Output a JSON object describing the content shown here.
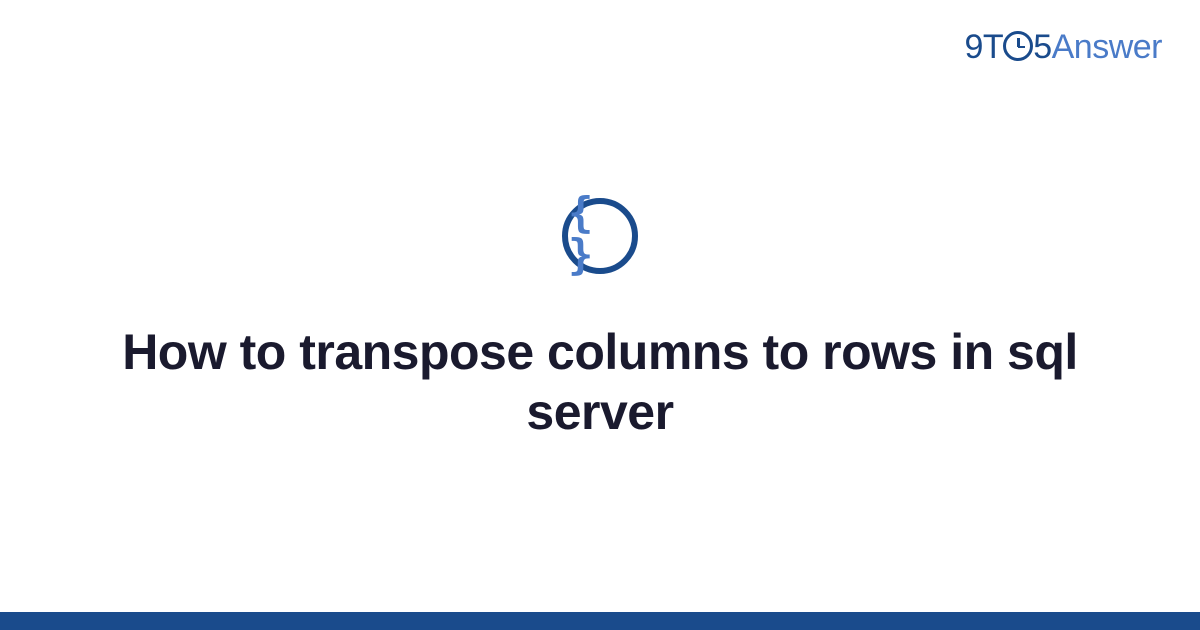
{
  "brand": {
    "part1": "9T",
    "part2": "5",
    "part3": "Answer"
  },
  "icon": {
    "name": "code-braces-icon",
    "glyph": "{ }"
  },
  "title": "How to transpose columns to rows in sql server",
  "colors": {
    "primary": "#1a4b8c",
    "accent": "#4a7bc8",
    "text": "#1a1a2e"
  }
}
